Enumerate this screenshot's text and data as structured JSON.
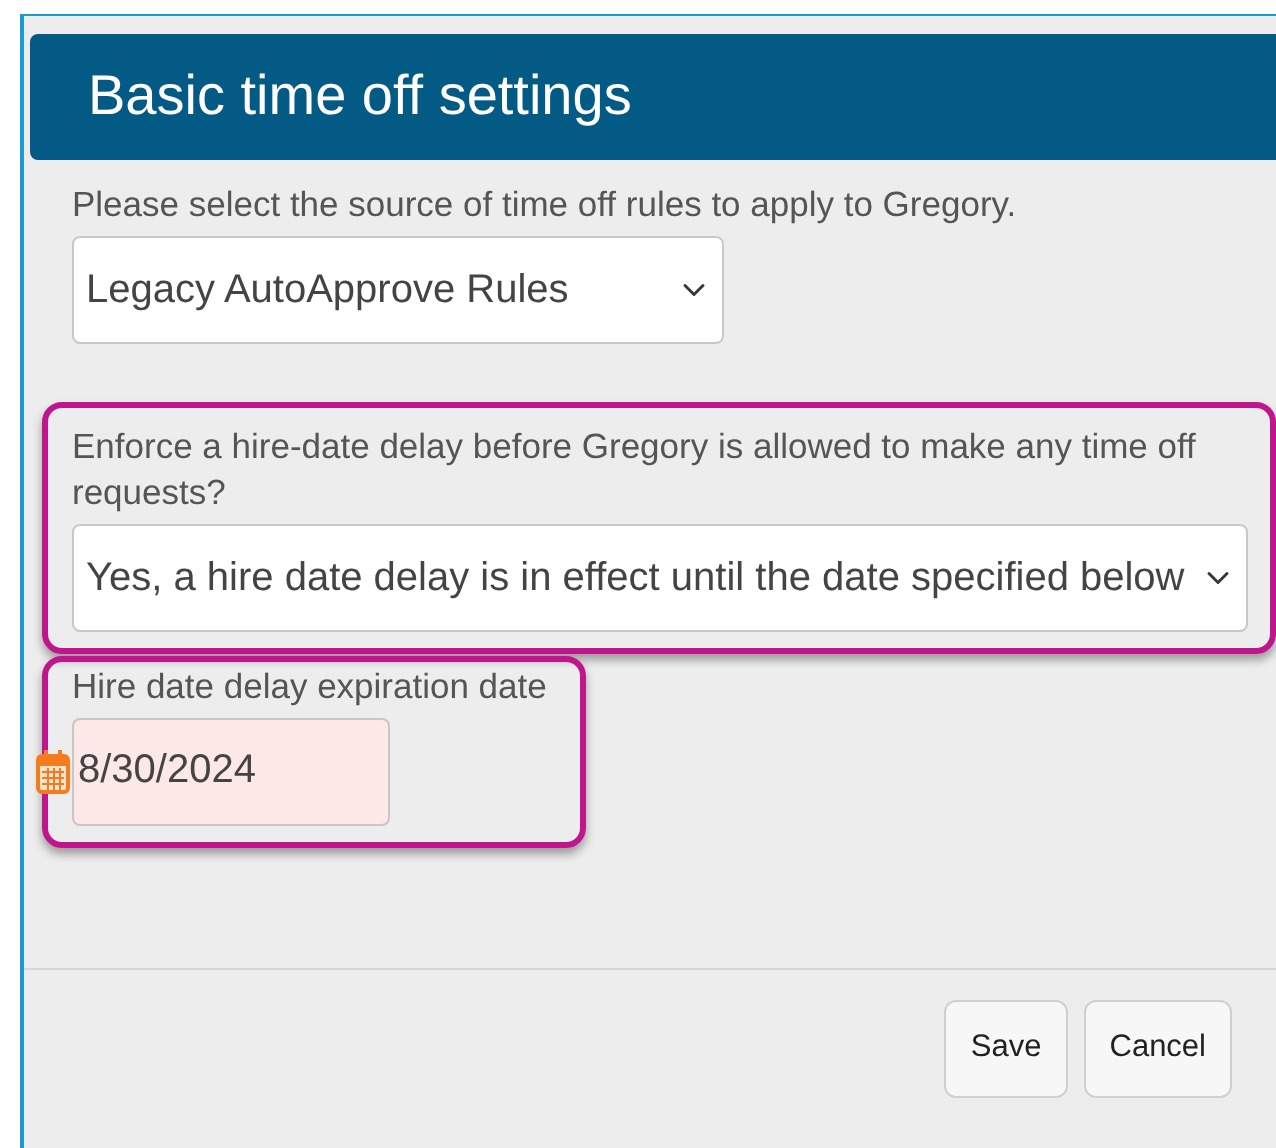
{
  "dialog": {
    "title": "Basic time off settings"
  },
  "fields": [
    {
      "kind": "select",
      "label": "Please select the source of time off rules to apply to Gregory.",
      "value": "Legacy AutoApprove Rules",
      "highlighted": false
    },
    {
      "kind": "select",
      "label": "Enforce a hire-date delay before Gregory is allowed to make any time off requests?",
      "value": "Yes, a hire date delay is in effect until the date specified below",
      "highlighted": true
    },
    {
      "kind": "date",
      "label": "Hire date delay expiration date",
      "value": "8/30/2024",
      "highlighted": true,
      "invalid": true
    }
  ],
  "buttons": [
    "Save",
    "Cancel"
  ]
}
